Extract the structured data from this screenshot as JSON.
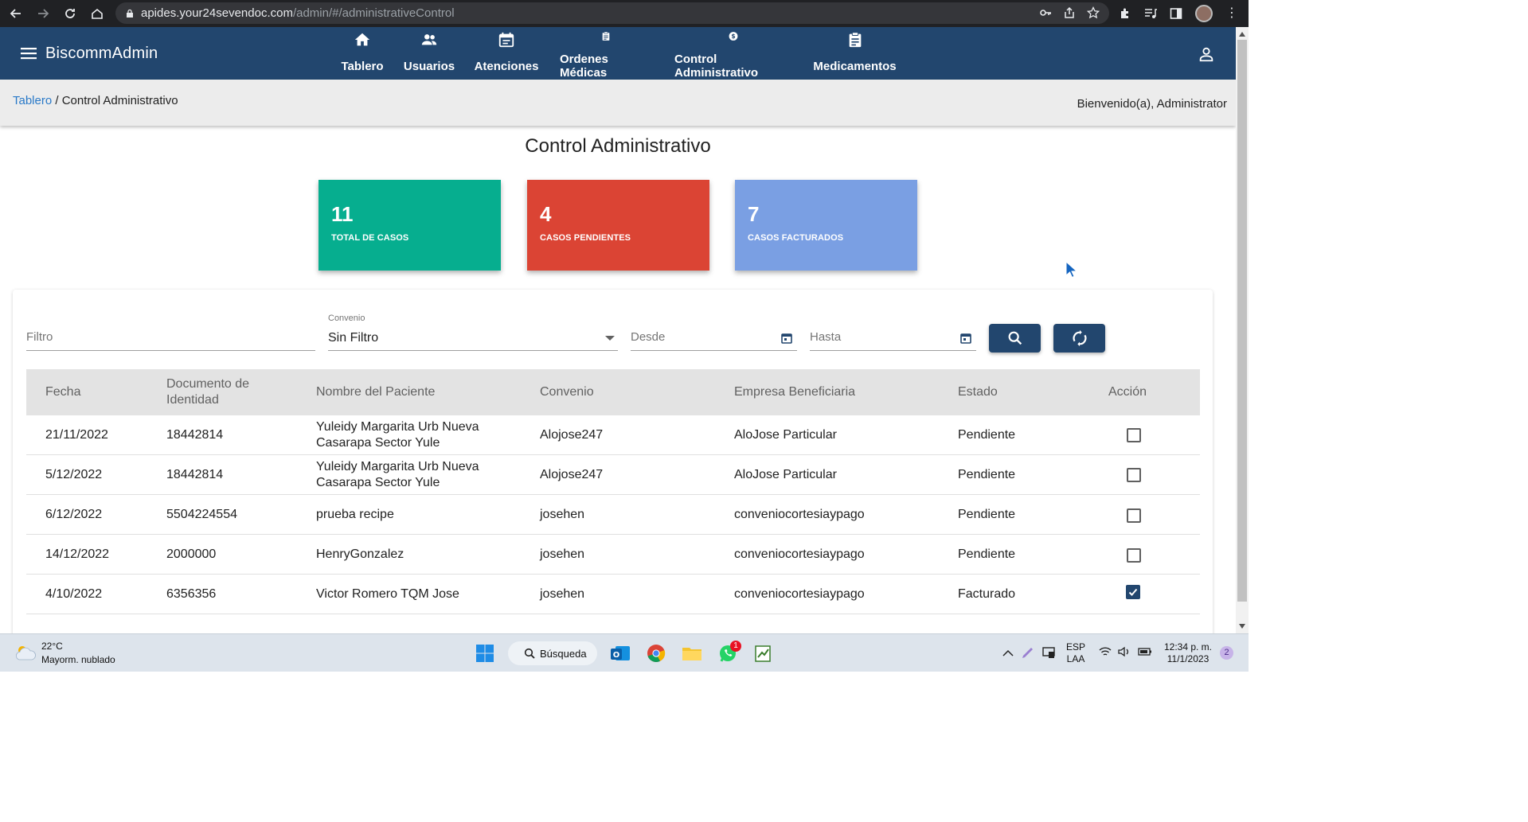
{
  "browser": {
    "url_host": "apides.your24sevendoc.com",
    "url_path": "/admin/#/administrativeControl"
  },
  "app": {
    "brand": "BiscommAdmin",
    "nav": [
      {
        "label": "Tablero",
        "icon": "home-icon"
      },
      {
        "label": "Usuarios",
        "icon": "users-icon"
      },
      {
        "label": "Atenciones",
        "icon": "calendar-icon"
      },
      {
        "label": "Ordenes Médicas",
        "icon": "clipboard-icon"
      },
      {
        "label": "Control Administrativo",
        "icon": "dollar-icon"
      },
      {
        "label": "Medicamentos",
        "icon": "clipboard-icon"
      }
    ]
  },
  "breadcrumb": {
    "home": "Tablero",
    "separator": " / ",
    "current": "Control Administrativo"
  },
  "welcome": "Bienvenido(a), Administrator",
  "page_title": "Control Administrativo",
  "stats": [
    {
      "value": "11",
      "label": "TOTAL DE CASOS",
      "color": "#06ae8f"
    },
    {
      "value": "4",
      "label": "CASOS PENDIENTES",
      "color": "#db4434"
    },
    {
      "value": "7",
      "label": "CASOS FACTURADOS",
      "color": "#7a9fe3"
    }
  ],
  "filters": {
    "filtro_placeholder": "Filtro",
    "convenio_label": "Convenio",
    "convenio_value": "Sin Filtro",
    "desde_placeholder": "Desde",
    "hasta_placeholder": "Hasta"
  },
  "table": {
    "headers": [
      "Fecha",
      "Documento de Identidad",
      "Nombre del Paciente",
      "Convenio",
      "Empresa Beneficiaria",
      "Estado",
      "Acción"
    ],
    "rows": [
      {
        "fecha": "21/11/2022",
        "documento": "18442814",
        "nombre": "Yuleidy Margarita Urb Nueva Casarapa Sector Yule",
        "convenio": "Alojose247",
        "empresa": "AloJose Particular",
        "estado": "Pendiente",
        "checked": false
      },
      {
        "fecha": "5/12/2022",
        "documento": "18442814",
        "nombre": "Yuleidy Margarita Urb Nueva Casarapa Sector Yule",
        "convenio": "Alojose247",
        "empresa": "AloJose Particular",
        "estado": "Pendiente",
        "checked": false
      },
      {
        "fecha": "6/12/2022",
        "documento": "5504224554",
        "nombre": "prueba recipe",
        "convenio": "josehen",
        "empresa": "conveniocortesiaypago",
        "estado": "Pendiente",
        "checked": false
      },
      {
        "fecha": "14/12/2022",
        "documento": "2000000",
        "nombre": "HenryGonzalez",
        "convenio": "josehen",
        "empresa": "conveniocortesiaypago",
        "estado": "Pendiente",
        "checked": false
      },
      {
        "fecha": "4/10/2022",
        "documento": "6356356",
        "nombre": "Victor Romero TQM Jose",
        "convenio": "josehen",
        "empresa": "conveniocortesiaypago",
        "estado": "Facturado",
        "checked": true
      }
    ]
  },
  "taskbar": {
    "temperature": "22°C",
    "weather": "Mayorm. nublado",
    "search_label": "Búsqueda",
    "whatsapp_badge": "1",
    "lang_top": "ESP",
    "lang_bottom": "LAA",
    "time": "12:34 p. m.",
    "date": "11/1/2023",
    "notifications": "2"
  }
}
